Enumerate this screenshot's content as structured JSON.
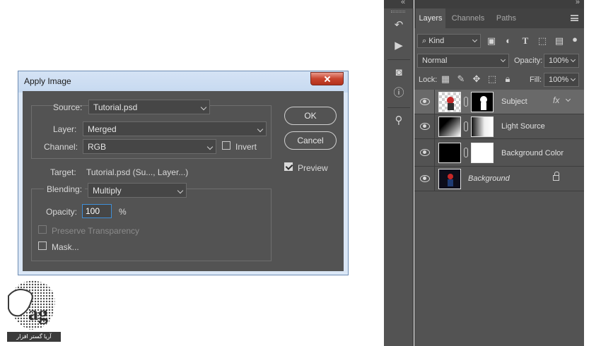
{
  "dialog": {
    "title": "Apply Image",
    "source_label": "Source:",
    "source_value": "Tutorial.psd",
    "layer_label": "Layer:",
    "layer_value": "Merged",
    "channel_label": "Channel:",
    "channel_value": "RGB",
    "invert_label": "Invert",
    "invert_checked": false,
    "target_label": "Target:",
    "target_value": "Tutorial.psd (Su..., Layer...)",
    "blending_label": "Blending:",
    "blending_value": "Multiply",
    "opacity_label": "Opacity:",
    "opacity_value": "100",
    "opacity_unit": "%",
    "preserve_label": "Preserve Transparency",
    "preserve_checked": false,
    "mask_label": "Mask...",
    "mask_checked": false,
    "ok_label": "OK",
    "cancel_label": "Cancel",
    "preview_label": "Preview",
    "preview_checked": true
  },
  "layers_panel": {
    "tabs": [
      "Layers",
      "Channels",
      "Paths"
    ],
    "active_tab": "Layers",
    "filter_value": "Kind",
    "blend_mode": "Normal",
    "opacity_label": "Opacity:",
    "opacity_value": "100%",
    "lock_label": "Lock:",
    "fill_label": "Fill:",
    "fill_value": "100%",
    "layers": [
      {
        "name": "Subject",
        "selected": true,
        "has_fx": true,
        "fx_label": "fx"
      },
      {
        "name": "Light Source",
        "selected": false
      },
      {
        "name": "Background Color",
        "selected": false
      },
      {
        "name": "Background",
        "selected": false,
        "locked": true
      }
    ]
  },
  "colors": {
    "panel_bg": "#535353",
    "selected_layer": "#696969",
    "input_focus": "#3f8fd8",
    "title_close": "#c8442e"
  }
}
